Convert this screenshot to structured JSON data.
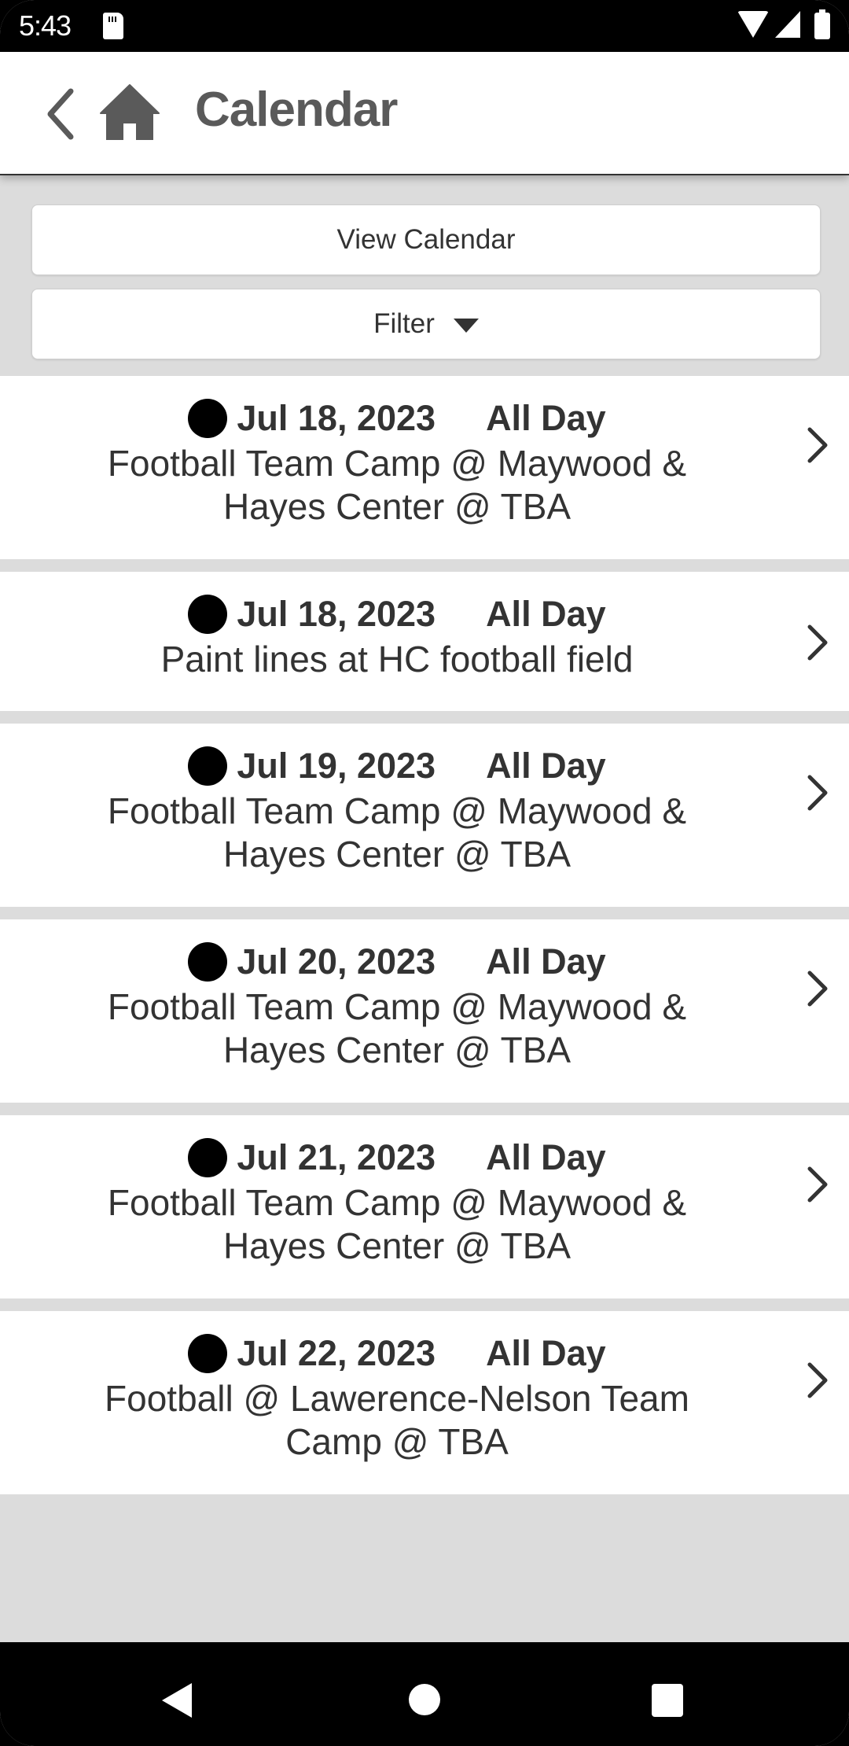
{
  "status_bar": {
    "time": "5:43",
    "icons": [
      "sd-card-icon",
      "wifi-icon",
      "signal-icon",
      "battery-icon"
    ]
  },
  "header": {
    "title": "Calendar",
    "back_icon": "chevron-left-icon",
    "home_icon": "home-icon"
  },
  "controls": {
    "view_calendar_label": "View Calendar",
    "filter_label": "Filter",
    "filter_icon": "caret-down-icon"
  },
  "events": [
    {
      "date": "Jul 18, 2023",
      "time": "All Day",
      "title": "Football Team Camp @ Maywood & Hayes Center @ TBA",
      "dot_color": "#000000"
    },
    {
      "date": "Jul 18, 2023",
      "time": "All Day",
      "title": "Paint lines at HC football field",
      "dot_color": "#000000"
    },
    {
      "date": "Jul 19, 2023",
      "time": "All Day",
      "title": "Football Team Camp @ Maywood & Hayes Center @ TBA",
      "dot_color": "#000000"
    },
    {
      "date": "Jul 20, 2023",
      "time": "All Day",
      "title": "Football Team Camp @ Maywood & Hayes Center @ TBA",
      "dot_color": "#000000"
    },
    {
      "date": "Jul 21, 2023",
      "time": "All Day",
      "title": "Football Team Camp @ Maywood & Hayes Center @ TBA",
      "dot_color": "#000000"
    },
    {
      "date": "Jul 22, 2023",
      "time": "All Day",
      "title": "Football @ Lawerence-Nelson Team Camp @ TBA",
      "dot_color": "#000000"
    }
  ],
  "nav_bar": {
    "buttons": [
      "back-triangle-icon",
      "home-circle-icon",
      "recents-square-icon"
    ]
  }
}
